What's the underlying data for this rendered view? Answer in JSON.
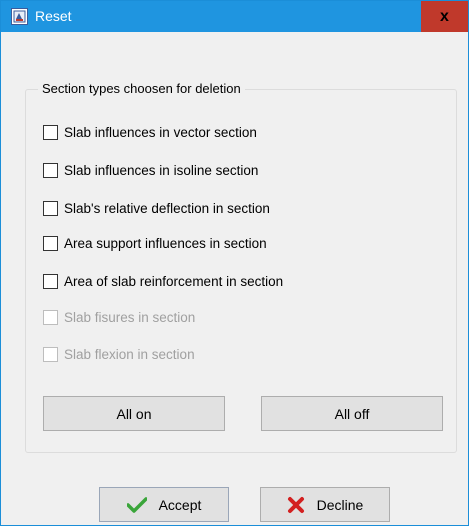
{
  "window": {
    "title": "Reset",
    "close_label": "x"
  },
  "group": {
    "legend": "Section types choosen for deletion"
  },
  "checkboxes": [
    {
      "label": "Slab influences in vector section",
      "checked": false,
      "enabled": true
    },
    {
      "label": "Slab influences in isoline section",
      "checked": false,
      "enabled": true
    },
    {
      "label": "Slab's relative deflection in section",
      "checked": false,
      "enabled": true
    },
    {
      "label": "Area support influences in section",
      "checked": false,
      "enabled": true
    },
    {
      "label": "Area of slab reinforcement in section",
      "checked": false,
      "enabled": true
    },
    {
      "label": "Slab fisures in section",
      "checked": false,
      "enabled": false
    },
    {
      "label": "Slab flexion in section",
      "checked": false,
      "enabled": false
    }
  ],
  "buttons": {
    "all_on": "All on",
    "all_off": "All off",
    "accept": "Accept",
    "decline": "Decline"
  },
  "icons": {
    "accept": "checkmark-icon",
    "decline": "red-x-icon",
    "app": "app-icon"
  },
  "colors": {
    "titlebar": "#1f95e0",
    "close": "#c0392b",
    "accept_icon": "#3aa53a",
    "decline_icon": "#d32020"
  }
}
